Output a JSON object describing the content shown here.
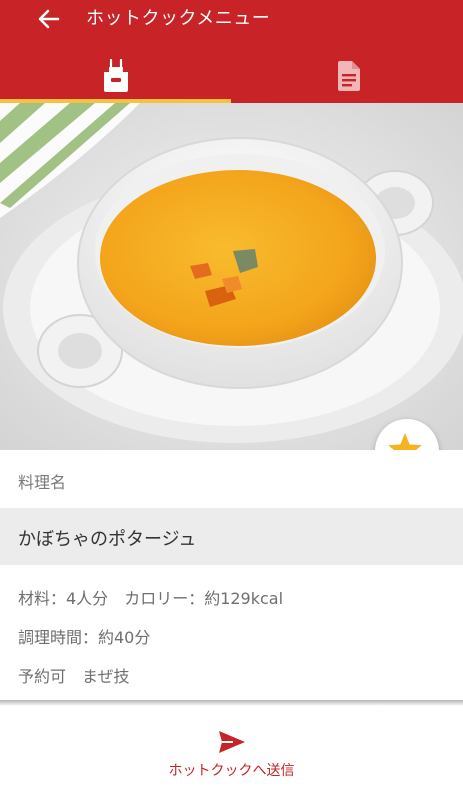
{
  "header": {
    "title": "ホットクックメニュー",
    "bg_color": "#c82327",
    "indicator_color": "#f5c242"
  },
  "icons": {
    "back": "arrow-left-icon",
    "tab_recipe": "apron-icon",
    "tab_detail": "document-icon",
    "favorite": "star-plus-icon",
    "send": "paper-plane-icon"
  },
  "tabs": [
    {
      "name": "recipe",
      "selected": true
    },
    {
      "name": "detail",
      "selected": false
    }
  ],
  "recipe": {
    "section_label": "料理名",
    "name": "かぼちゃのポタージュ",
    "ingredients": "材料：4人分",
    "calories": "カロリー：約129kcal",
    "cook_time": "調理時間：約40分",
    "reserve": "予約可",
    "mix": "まぜ技"
  },
  "footer": {
    "send_label": "ホットクックへ送信"
  }
}
